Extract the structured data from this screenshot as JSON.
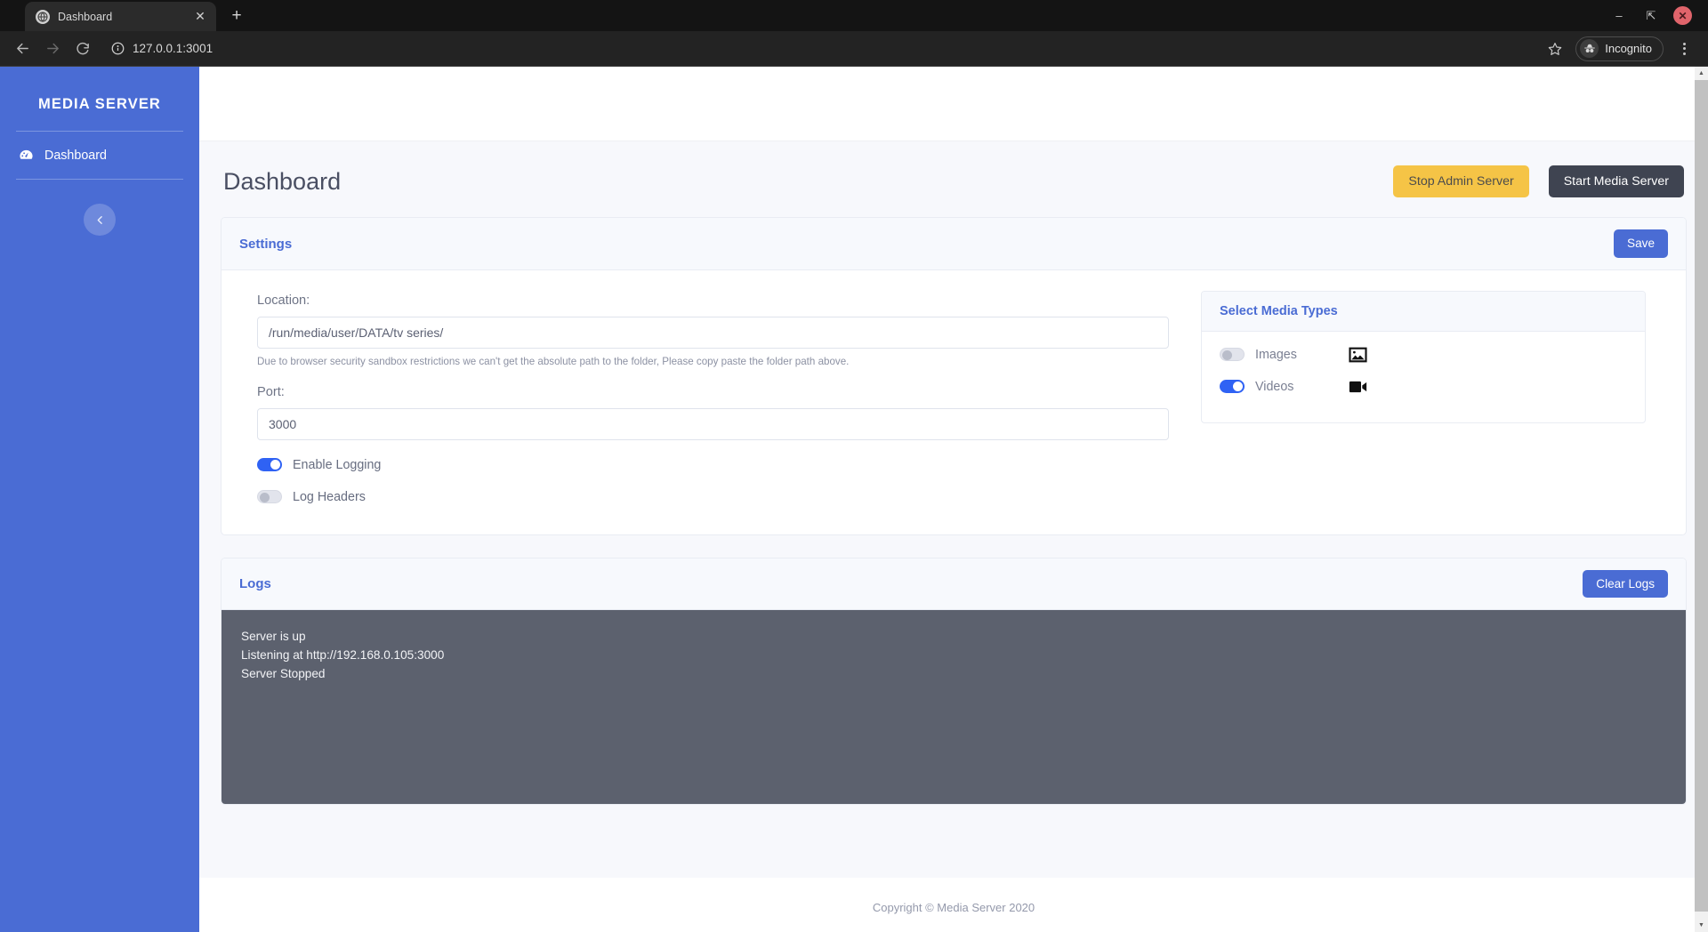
{
  "browser": {
    "tab": {
      "title": "Dashboard",
      "favicon_icon": "globe-icon",
      "close_icon": "close-icon"
    },
    "new_tab_label": "+",
    "window": {
      "minimize": "–",
      "maximize": "⇱",
      "close": "✕"
    },
    "nav": {
      "back_icon": "arrow-left-icon",
      "forward_icon": "arrow-right-icon",
      "reload_icon": "reload-icon"
    },
    "omnibox": {
      "info_icon": "info-circle-icon",
      "url": "127.0.0.1:3001"
    },
    "star_icon": "star-icon",
    "profile": {
      "label": "Incognito",
      "icon": "incognito-icon"
    },
    "menu_icon": "kebab-menu-icon"
  },
  "sidebar": {
    "brand": "MEDIA SERVER",
    "items": [
      {
        "label": "Dashboard",
        "icon": "tachometer-dashboard-icon"
      }
    ],
    "collapse_icon": "chevron-left-icon",
    "background": "#4a6cd4"
  },
  "page": {
    "title": "Dashboard",
    "actions": [
      {
        "label": "Stop Admin Server",
        "style": "warning",
        "color": "#f5c446"
      },
      {
        "label": "Start Media Server",
        "style": "dark",
        "color": "#3f4451"
      }
    ]
  },
  "settings": {
    "heading": "Settings",
    "save_label": "Save",
    "location": {
      "label": "Location:",
      "value": "/run/media/user/DATA/tv series/",
      "placeholder": "",
      "help": "Due to browser security sandbox restrictions we can't get the absolute path to the folder, Please copy paste the folder path above."
    },
    "port": {
      "label": "Port:",
      "value": "3000",
      "placeholder": ""
    },
    "toggles": [
      {
        "label": "Enable Logging",
        "state": "on"
      },
      {
        "label": "Log Headers",
        "state": "off"
      }
    ]
  },
  "media_types": {
    "heading": "Select Media Types",
    "items": [
      {
        "label": "Images",
        "state": "off",
        "icon": "image-icon"
      },
      {
        "label": "Videos",
        "state": "on",
        "icon": "video-camera-icon"
      }
    ]
  },
  "logs": {
    "heading": "Logs",
    "clear_label": "Clear Logs",
    "lines": [
      "Server is up",
      "Listening at http://192.168.0.105:3000",
      "Server Stopped"
    ]
  },
  "footer": {
    "text": "Copyright © Media Server 2020"
  },
  "theme": {
    "accent": "#4a6cd4",
    "toggle_on": "#2f62f4",
    "logs_bg": "#5c616e",
    "warning": "#f5c446",
    "dark": "#3f4451"
  }
}
